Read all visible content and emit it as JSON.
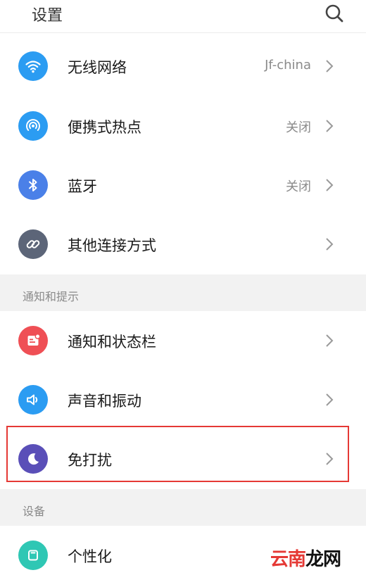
{
  "header": {
    "title": "设置",
    "search_icon": "search-icon"
  },
  "colors": {
    "wifi": "#2b9cf2",
    "hotspot": "#2b9cf2",
    "bluetooth": "#4a80e8",
    "other": "#5c6578",
    "notify": "#ef4f55",
    "sound": "#2b9cf2",
    "dnd": "#5a4fb8",
    "personal": "#2fc7b4",
    "highlight": "#e53935"
  },
  "rows": [
    {
      "label": "无线网络",
      "value": "Jf-china",
      "icon": "wifi-icon"
    },
    {
      "label": "便携式热点",
      "value": "关闭",
      "icon": "hotspot-icon"
    },
    {
      "label": "蓝牙",
      "value": "关闭",
      "icon": "bluetooth-icon"
    },
    {
      "label": "其他连接方式",
      "value": "",
      "icon": "link-icon"
    }
  ],
  "section_notify": {
    "title": "通知和提示"
  },
  "notify_rows": [
    {
      "label": "通知和状态栏",
      "icon": "notification-icon"
    },
    {
      "label": "声音和振动",
      "icon": "speaker-icon"
    },
    {
      "label": "免打扰",
      "icon": "moon-icon"
    }
  ],
  "section_device": {
    "title": "设备"
  },
  "device_rows": [
    {
      "label": "个性化",
      "icon": "personalize-icon"
    }
  ],
  "watermark": {
    "part1": "云南",
    "part2": "龙网"
  }
}
